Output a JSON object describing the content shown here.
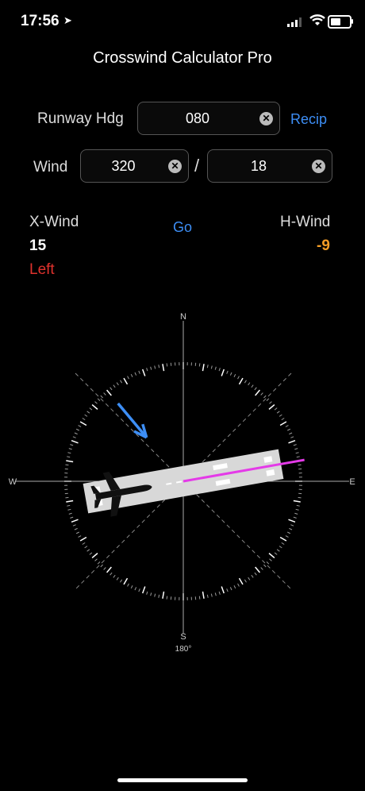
{
  "status": {
    "time": "17:56"
  },
  "header": {
    "title": "Crosswind Calculator Pro"
  },
  "runway": {
    "label": "Runway Hdg",
    "value": "080",
    "recip_label": "Recip"
  },
  "wind": {
    "label": "Wind",
    "direction": "320",
    "separator": "/",
    "speed": "18"
  },
  "result": {
    "xwind_label": "X-Wind",
    "xwind_value": "15",
    "xwind_side": "Left",
    "go_label": "Go",
    "hwind_label": "H-Wind",
    "hwind_value": "-9"
  },
  "compass": {
    "north": "N",
    "south": "S",
    "east": "E",
    "west": "W",
    "south_heading": "180°",
    "runway_heading_deg": 80,
    "wind_direction_deg": 320
  },
  "colors": {
    "accent": "#3d8ef5",
    "left": "#e0322d",
    "headwind": "#f39c26",
    "centerline": "#e43ae8"
  }
}
